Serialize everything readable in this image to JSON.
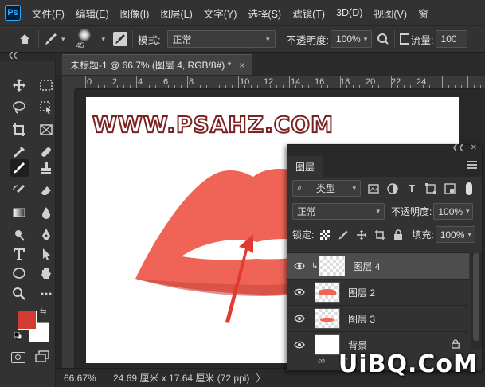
{
  "app": {
    "logo": "Ps"
  },
  "menu": [
    "文件(F)",
    "编辑(E)",
    "图像(I)",
    "图层(L)",
    "文字(Y)",
    "选择(S)",
    "滤镜(T)",
    "3D(D)",
    "视图(V)",
    "窗"
  ],
  "options": {
    "brush_size": "45",
    "mode_label": "模式:",
    "mode_value": "正常",
    "opacity_label": "不透明度:",
    "opacity_value": "100%",
    "flow_label": "流量:",
    "flow_value": "100"
  },
  "document": {
    "tab_title": "未标题-1 @ 66.7% (图层 4, RGB/8#) *",
    "close": "×",
    "ruler_marks": [
      "0",
      "2",
      "4",
      "6",
      "8",
      "10",
      "12",
      "14",
      "16",
      "18",
      "20",
      "22",
      "24"
    ],
    "watermark": "WWW.PSAHZ.COM"
  },
  "status": {
    "zoom": "66.67%",
    "doc_info": "24.69 厘米 x 17.64 厘米 (72 ppi)",
    "arrow": "〉"
  },
  "layers_panel": {
    "tab": "图层",
    "filter_value": "类型",
    "blend_mode": "正常",
    "opacity_label": "不透明度:",
    "opacity_value": "100%",
    "lock_label": "锁定:",
    "fill_label": "填充:",
    "fill_value": "100%",
    "layers": [
      {
        "name": "图层 4",
        "selected": true,
        "clipped": true
      },
      {
        "name": "图层 2",
        "selected": false
      },
      {
        "name": "图层 3",
        "selected": false
      },
      {
        "name": "背景",
        "selected": false,
        "locked": true
      }
    ]
  },
  "colors": {
    "foreground": "#d23a32",
    "background": "#ffffff",
    "lip_main": "#ef6457",
    "lip_shadow": "#c9483f"
  },
  "overlay": {
    "site_mark": "UiBQ.CoM"
  }
}
